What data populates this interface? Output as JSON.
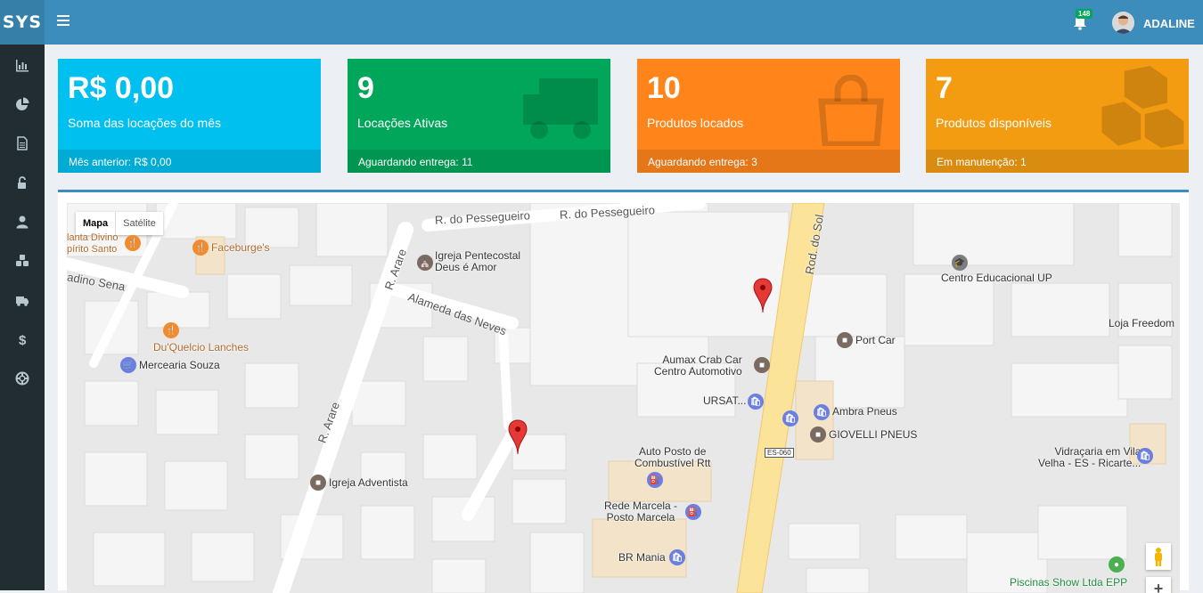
{
  "app": {
    "logo": "SYS"
  },
  "sidebar": {
    "items": [
      {
        "icon": "bar-chart-icon"
      },
      {
        "icon": "pie-chart-icon"
      },
      {
        "icon": "document-icon"
      },
      {
        "icon": "unlock-icon"
      },
      {
        "icon": "user-icon"
      },
      {
        "icon": "cubes-icon"
      },
      {
        "icon": "truck-icon"
      },
      {
        "icon": "dollar-icon"
      },
      {
        "icon": "lifebuoy-icon"
      }
    ]
  },
  "topbar": {
    "notifications_count": "148",
    "username": "ADALINE"
  },
  "cards": [
    {
      "value": "R$ 0,00",
      "label": "Soma das locações do mês",
      "footer": "Mês anterior: R$ 0,00",
      "color": "#00c0ef",
      "icon": "none"
    },
    {
      "value": "9",
      "label": "Locações Ativas",
      "footer": "Aguardando entrega: 11",
      "color": "#00a65a",
      "icon": "truck-icon"
    },
    {
      "value": "10",
      "label": "Produtos locados",
      "footer": "Aguardando entrega: 3",
      "color": "#ff851b",
      "icon": "shopping-bag-icon"
    },
    {
      "value": "7",
      "label": "Produtos disponíveis",
      "footer": "Em manutenção: 1",
      "color": "#f39c12",
      "icon": "cubes-icon"
    }
  ],
  "map": {
    "type_buttons": {
      "map": "Mapa",
      "satellite": "Satélite"
    },
    "streets": {
      "pessegueiro_1": "R. do Pessegueiro",
      "pessegueiro_2": "R. do Pessegueiro",
      "arare_1": "R. Arare",
      "arare_2": "R. Arare",
      "alameda": "Alameda das Neves",
      "sena": "adino Sena",
      "rod_sol": "Rod. do Sol",
      "shield": "ES-060"
    },
    "places": {
      "divino": "lanta Divino\npírito Santo",
      "faceburge": "Faceburge's",
      "igreja_pentecostal": "Igreja Pentecostal\nDeus é Amor",
      "duquelcio": "Du'Quelcio Lanches",
      "mercearia": "Mercearia Souza",
      "aumax": "Aumax Crab Car\nCentro Automotivo",
      "ursat": "URSAT...",
      "port_car": "Port Car",
      "centro_educacional": "Centro Educacional UP",
      "loja_freedom": "Loja Freedom",
      "ambra": "Ambra Pneus",
      "giovelli": "GIOVELLI PNEUS",
      "auto_posto": "Auto Posto de\nCombustível Rtt",
      "rede_marcela": "Rede Marcela -\nPosto Marcela",
      "br_mania": "BR Mania",
      "igreja_adventista": "Igreja Adventista",
      "vidracaria": "Vidraçaria em Vila\nVelha - ES - Ricarte...",
      "piscinas": "Piscinas Show Ltda EPP"
    }
  }
}
